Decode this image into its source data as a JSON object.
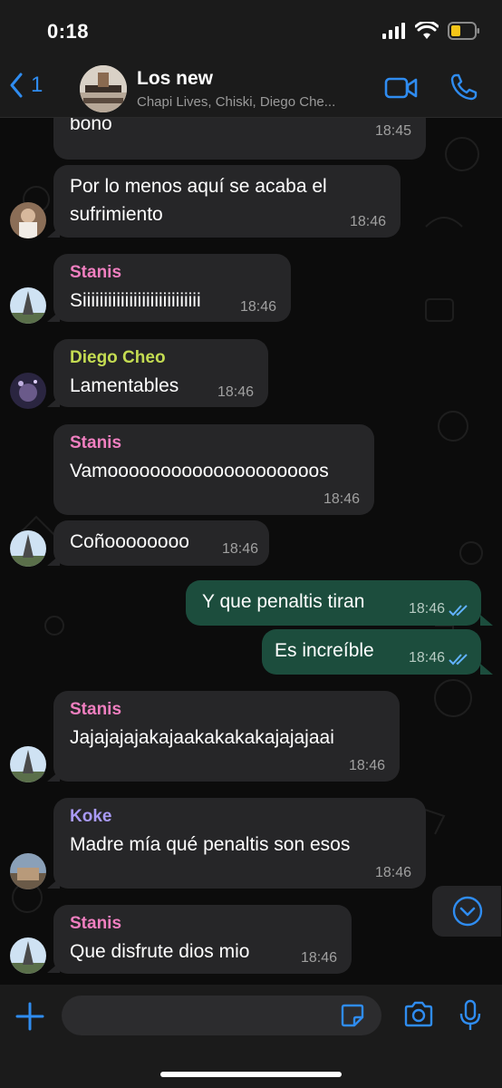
{
  "status_bar": {
    "time": "0:18"
  },
  "header": {
    "back_count": "1",
    "title": "Los new",
    "subtitle": "Chapi Lives, Chiski, Diego Che..."
  },
  "messages": [
    {
      "type": "in",
      "text": "bono",
      "time": "18:45"
    },
    {
      "type": "in",
      "text1": "Por lo menos aquí se acaba el",
      "text2": "sufrimiento",
      "time": "18:46"
    },
    {
      "type": "in",
      "sender": "Stanis",
      "text": "Siiiiiiiiiiiiiiiiiiiiiiiiiiii",
      "time": "18:46"
    },
    {
      "type": "in",
      "sender": "Diego Cheo",
      "text": "Lamentables",
      "time": "18:46"
    },
    {
      "type": "in",
      "sender": "Stanis",
      "text": "Vamoooooooooooooooooooos",
      "time": "18:46"
    },
    {
      "type": "in",
      "text": "Coñoooooooo",
      "time": "18:46"
    },
    {
      "type": "out",
      "text": "Y que penaltis tiran",
      "time": "18:46"
    },
    {
      "type": "out",
      "text": "Es increíble",
      "time": "18:46"
    },
    {
      "type": "in",
      "sender": "Stanis",
      "text": "Jajajajajakajaakakakakajajajaai",
      "time": "18:46"
    },
    {
      "type": "in",
      "sender": "Koke",
      "text": "Madre mía qué penaltis son esos",
      "time": "18:46"
    },
    {
      "type": "in",
      "sender": "Stanis",
      "text": "Que disfrute dios mio",
      "time": "18:46"
    }
  ],
  "colors": {
    "accent": "#2f8cf0",
    "incoming_bubble": "#262628",
    "outgoing_bubble": "#1c4d3d",
    "sender_stanis": "#f07fc0",
    "sender_diego": "#c4dc52",
    "sender_koke": "#a99af5"
  },
  "icons": [
    "back-chevron-icon",
    "video-call-icon",
    "phone-icon",
    "scroll-down-icon",
    "plus-icon",
    "sticker-icon",
    "camera-icon",
    "microphone-icon",
    "read-ticks-icon"
  ]
}
